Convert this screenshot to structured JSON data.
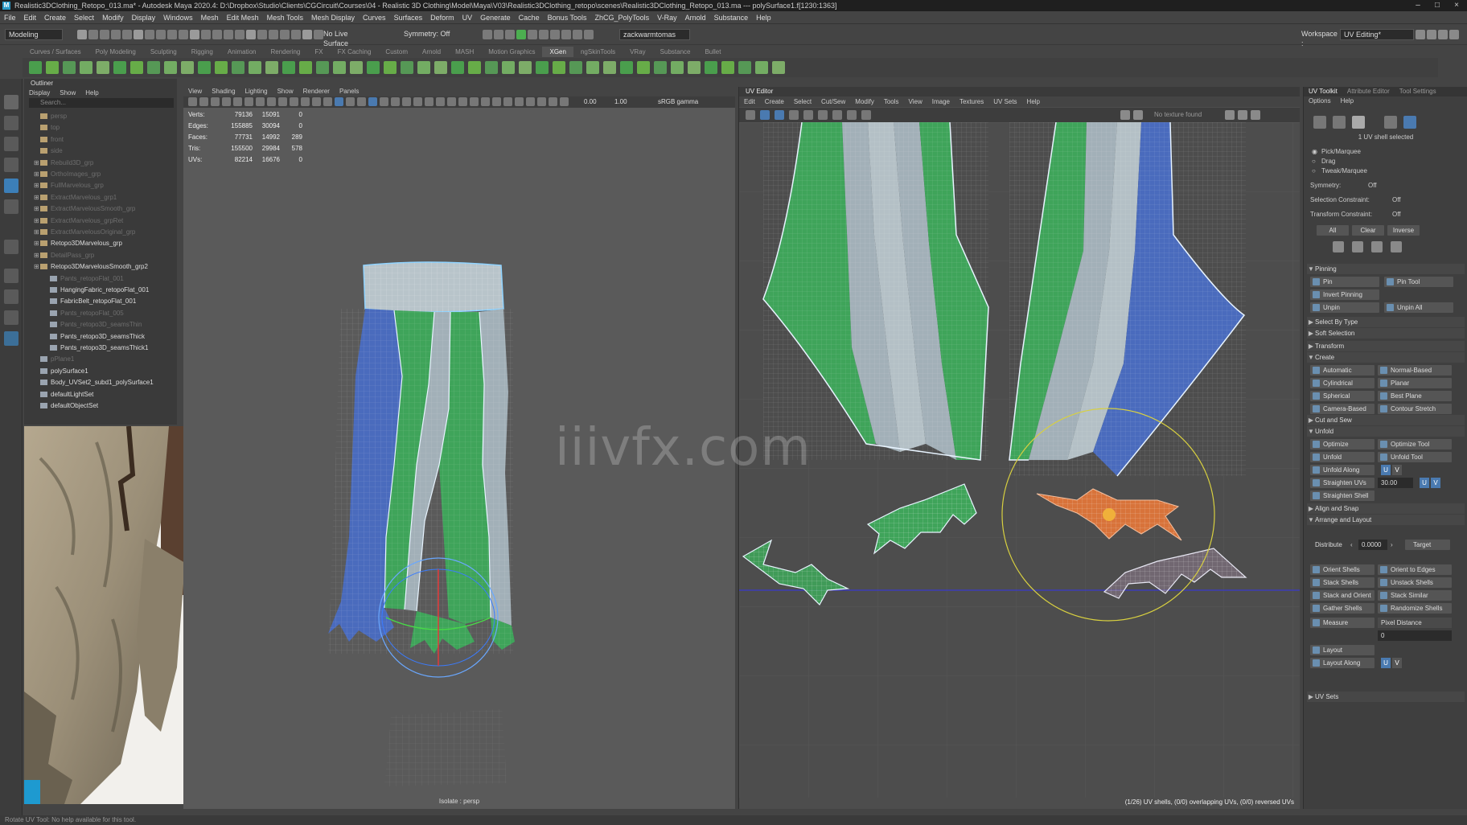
{
  "window": {
    "title": "Realistic3DClothing_Retopo_013.ma* - Autodesk Maya 2020.4: D:\\Dropbox\\Studio\\Clients\\CGCircuit\\Courses\\04 - Realistic 3D Clothing\\Model\\Maya\\V03\\Realistic3DClothing_retopo\\scenes\\Realistic3DClothing_Retopo_013.ma --- polySurface1.f[1230:1363]",
    "logo": "M"
  },
  "menubar": [
    "File",
    "Edit",
    "Create",
    "Select",
    "Modify",
    "Display",
    "Windows",
    "Mesh",
    "Edit Mesh",
    "Mesh Tools",
    "Mesh Display",
    "Curves",
    "Surfaces",
    "Deform",
    "UV",
    "Generate",
    "Cache",
    "Bonus Tools",
    "ZhCG_PolyTools",
    "V-Ray",
    "Arnold",
    "Substance",
    "Help"
  ],
  "statusline": {
    "mode": "Modeling",
    "live_surface": "No Live Surface",
    "symmetry": "Symmetry: Off",
    "user": "zackwarmtomas",
    "workspace_label": "Workspace :",
    "workspace": "UV Editing*"
  },
  "shelf_tabs": [
    "Curves / Surfaces",
    "Poly Modeling",
    "Sculpting",
    "Rigging",
    "Animation",
    "Rendering",
    "FX",
    "FX Caching",
    "Custom",
    "Arnold",
    "MASH",
    "Motion Graphics",
    "XGen",
    "ngSkinTools",
    "VRay",
    "Substance",
    "Bullet"
  ],
  "shelf_active": "XGen",
  "outliner": {
    "title": "Outliner",
    "menu": [
      "Display",
      "Show",
      "Help"
    ],
    "search_placeholder": "Search...",
    "items": [
      {
        "label": "persp",
        "dim": true,
        "indent": 0,
        "icon": "cam"
      },
      {
        "label": "top",
        "dim": true,
        "indent": 0,
        "icon": "cam"
      },
      {
        "label": "front",
        "dim": true,
        "indent": 0,
        "icon": "cam"
      },
      {
        "label": "side",
        "dim": true,
        "indent": 0,
        "icon": "cam"
      },
      {
        "label": "Rebuild3D_grp",
        "dim": true,
        "indent": 0,
        "icon": "grp"
      },
      {
        "label": "OrthoImages_grp",
        "dim": true,
        "indent": 0,
        "icon": "grp"
      },
      {
        "label": "FullMarvelous_grp",
        "dim": true,
        "indent": 0,
        "icon": "grp"
      },
      {
        "label": "ExtractMarvelous_grp1",
        "dim": true,
        "indent": 0,
        "icon": "grp"
      },
      {
        "label": "ExtractMarvelousSmooth_grp",
        "dim": true,
        "indent": 0,
        "icon": "grp"
      },
      {
        "label": "ExtractMarvelous_grpRet",
        "dim": true,
        "indent": 0,
        "icon": "grp"
      },
      {
        "label": "ExtractMarvelousOriginal_grp",
        "dim": true,
        "indent": 0,
        "icon": "grp"
      },
      {
        "label": "Retopo3DMarvelous_grp",
        "dim": false,
        "indent": 0,
        "icon": "grp"
      },
      {
        "label": "DetailPass_grp",
        "dim": true,
        "indent": 0,
        "icon": "grp"
      },
      {
        "label": "Retopo3DMarvelousSmooth_grp2",
        "dim": false,
        "indent": 0,
        "icon": "grp"
      },
      {
        "label": "Pants_retopoFlat_001",
        "dim": true,
        "indent": 1,
        "icon": "mesh"
      },
      {
        "label": "HangingFabric_retopoFlat_001",
        "dim": false,
        "indent": 1,
        "icon": "mesh"
      },
      {
        "label": "FabricBelt_retopoFlat_001",
        "dim": false,
        "indent": 1,
        "icon": "mesh"
      },
      {
        "label": "Pants_retopoFlat_005",
        "dim": true,
        "indent": 1,
        "icon": "mesh"
      },
      {
        "label": "Pants_retopo3D_seamsThin",
        "dim": true,
        "indent": 1,
        "icon": "mesh"
      },
      {
        "label": "Pants_retopo3D_seamsThick",
        "dim": false,
        "indent": 1,
        "icon": "mesh"
      },
      {
        "label": "Pants_retopo3D_seamsThick1",
        "dim": false,
        "indent": 1,
        "icon": "mesh"
      },
      {
        "label": "pPlane1",
        "dim": true,
        "indent": 0,
        "icon": "mesh"
      },
      {
        "label": "polySurface1",
        "dim": false,
        "indent": 0,
        "icon": "mesh"
      },
      {
        "label": "Body_UVSet2_subd1_polySurface1",
        "dim": false,
        "indent": 0,
        "icon": "mesh"
      },
      {
        "label": "defaultLightSet",
        "dim": false,
        "indent": 0,
        "icon": "set"
      },
      {
        "label": "defaultObjectSet",
        "dim": false,
        "indent": 0,
        "icon": "set"
      }
    ]
  },
  "viewport": {
    "menu": [
      "View",
      "Shading",
      "Lighting",
      "Show",
      "Renderer",
      "Panels"
    ],
    "num1": "0.00",
    "num2": "1.00",
    "colorspace": "sRGB gamma",
    "hud": [
      {
        "label": "Verts:",
        "a": "79136",
        "b": "15091",
        "c": "0"
      },
      {
        "label": "Edges:",
        "a": "155885",
        "b": "30094",
        "c": "0"
      },
      {
        "label": "Faces:",
        "a": "77731",
        "b": "14992",
        "c": "289"
      },
      {
        "label": "Tris:",
        "a": "155500",
        "b": "29984",
        "c": "578"
      },
      {
        "label": "UVs:",
        "a": "82214",
        "b": "16676",
        "c": "0"
      }
    ],
    "label": "Isolate : persp"
  },
  "uv_editor": {
    "title": "UV Editor",
    "menu": [
      "Edit",
      "Create",
      "Select",
      "Cut/Sew",
      "Modify",
      "Tools",
      "View",
      "Image",
      "Textures",
      "UV Sets",
      "Help"
    ],
    "texture_label": "No texture found",
    "status": "(1/26) UV shells, (0/0) overlapping UVs, (0/0) reversed UVs"
  },
  "uv_toolkit": {
    "tabs": [
      "UV Toolkit",
      "Attribute Editor",
      "Tool Settings"
    ],
    "menu": [
      "Options",
      "Help"
    ],
    "shell_selected": "1 UV shell selected",
    "pick_options": [
      "Pick/Marquee",
      "Drag",
      "Tweak/Marquee"
    ],
    "symmetry_label": "Symmetry:",
    "symmetry_value": "Off",
    "sel_constraint_label": "Selection Constraint:",
    "sel_constraint_value": "Off",
    "transform_constraint_label": "Transform Constraint:",
    "transform_constraint_value": "Off",
    "sel_buttons": [
      "All",
      "Clear",
      "Inverse"
    ],
    "pinning": "Pinning",
    "pin": "Pin",
    "pin_tool": "Pin Tool",
    "invert_pinning": "Invert Pinning",
    "unpin": "Unpin",
    "unpin_all": "Unpin All",
    "select_by_type": "Select By Type",
    "soft_selection": "Soft Selection",
    "transform": "Transform",
    "create": "Create",
    "create_buttons": [
      "Automatic",
      "Normal-Based",
      "Cylindrical",
      "Planar",
      "Spherical",
      "Best Plane",
      "Camera-Based",
      "Contour Stretch"
    ],
    "cut_and_sew": "Cut and Sew",
    "unfold": "Unfold",
    "optimize": "Optimize",
    "optimize_tool": "Optimize Tool",
    "unfold_btn": "Unfold",
    "unfold_tool": "Unfold Tool",
    "unfold_along": "Unfold Along",
    "straighten_uvs": "Straighten UVs",
    "straighten_value": "30.00",
    "straighten_shell": "Straighten Shell",
    "u": "U",
    "v": "V",
    "align_and_snap": "Align and Snap",
    "arrange_and_layout": "Arrange and Layout",
    "distribute": "Distribute",
    "distribute_value": "0.0000",
    "target": "Target",
    "arrange_buttons": [
      "Orient Shells",
      "Orient to Edges",
      "Stack Shells",
      "Unstack Shells",
      "Stack and Orient",
      "Stack Similar",
      "Gather Shells",
      "Randomize Shells"
    ],
    "measure": "Measure",
    "measure_mode": "Pixel Distance",
    "measure_value": "0",
    "layout": "Layout",
    "layout_along": "Layout Along",
    "uv_sets": "UV Sets"
  },
  "bottom_status": "Rotate UV Tool: No help available for this tool.",
  "watermark": "iiivfx.com",
  "colors": {
    "green": "#3fa45a",
    "blue": "#4a6bbd",
    "gray": "#9aa8b0",
    "orange": "#d8733a",
    "accent": "#4a7ab0"
  }
}
